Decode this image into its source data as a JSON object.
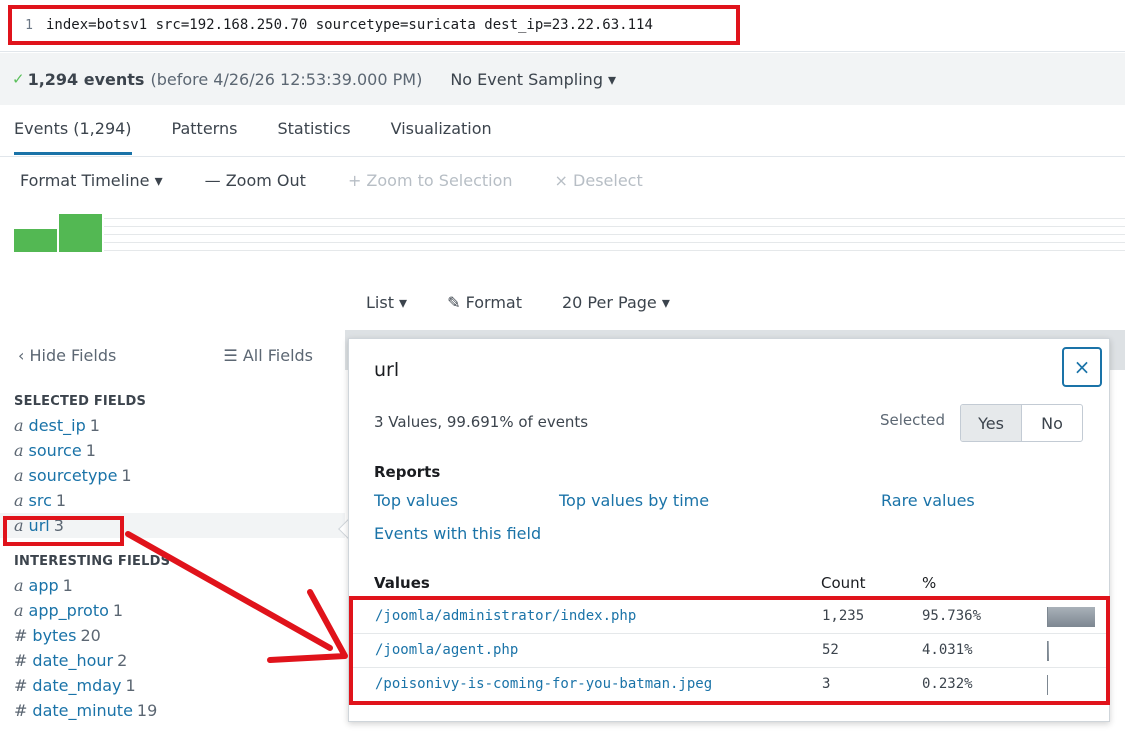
{
  "search": {
    "line_number": "1",
    "query": "index=botsv1 src=192.168.250.70 sourcetype=suricata dest_ip=23.22.63.114"
  },
  "status": {
    "check": "✓",
    "event_count": "1,294 events",
    "before": "(before 4/26/26 12:53:39.000 PM)",
    "sampling": "No Event Sampling ▾"
  },
  "tabs": [
    {
      "label": "Events (1,294)"
    },
    {
      "label": "Patterns"
    },
    {
      "label": "Statistics"
    },
    {
      "label": "Visualization"
    }
  ],
  "timeline_toolbar": {
    "format": "Format Timeline ▾",
    "zoom_out": "— Zoom Out",
    "zoom_selection": "+ Zoom to Selection",
    "deselect": "× Deselect"
  },
  "list_toolbar": {
    "list": "List ▾",
    "format": "Format",
    "per_page": "20 Per Page ▾"
  },
  "sidebar": {
    "hide_fields": "‹ Hide Fields",
    "all_fields": "All Fields",
    "selected_heading": "SELECTED FIELDS",
    "selected": [
      {
        "type": "a",
        "name": "dest_ip",
        "count": "1"
      },
      {
        "type": "a",
        "name": "source",
        "count": "1"
      },
      {
        "type": "a",
        "name": "sourcetype",
        "count": "1"
      },
      {
        "type": "a",
        "name": "src",
        "count": "1"
      },
      {
        "type": "a",
        "name": "url",
        "count": "3"
      }
    ],
    "interesting_heading": "INTERESTING FIELDS",
    "interesting": [
      {
        "type": "a",
        "name": "app",
        "count": "1"
      },
      {
        "type": "a",
        "name": "app_proto",
        "count": "1"
      },
      {
        "type": "#",
        "name": "bytes",
        "count": "20"
      },
      {
        "type": "#",
        "name": "date_hour",
        "count": "2"
      },
      {
        "type": "#",
        "name": "date_mday",
        "count": "1"
      },
      {
        "type": "#",
        "name": "date_minute",
        "count": "19"
      }
    ]
  },
  "popup": {
    "title": "url",
    "close": "×",
    "summary": "3 Values, 99.691% of events",
    "selected_label": "Selected",
    "yes": "Yes",
    "no": "No",
    "reports_label": "Reports",
    "top_values": "Top values",
    "top_values_by_time": "Top values by time",
    "rare_values": "Rare values",
    "events_with_field": "Events with this field",
    "values_head": "Values",
    "count_head": "Count",
    "pct_head": "%",
    "values": [
      {
        "url": "/joomla/administrator/index.php",
        "count": "1,235",
        "pct": "95.736%",
        "fraction": 0.95736
      },
      {
        "url": "/joomla/agent.php",
        "count": "52",
        "pct": "4.031%",
        "fraction": 0.04031
      },
      {
        "url": "/poisonivy-is-coming-for-you-batman.jpeg",
        "count": "3",
        "pct": "0.232%",
        "fraction": 0.00232
      }
    ]
  },
  "timeline_data": {
    "bins": [
      0.6,
      1.0
    ]
  },
  "colors": {
    "accent": "#1a73a8",
    "annotation_red": "#e0131b",
    "timeline_green": "#53b853"
  }
}
